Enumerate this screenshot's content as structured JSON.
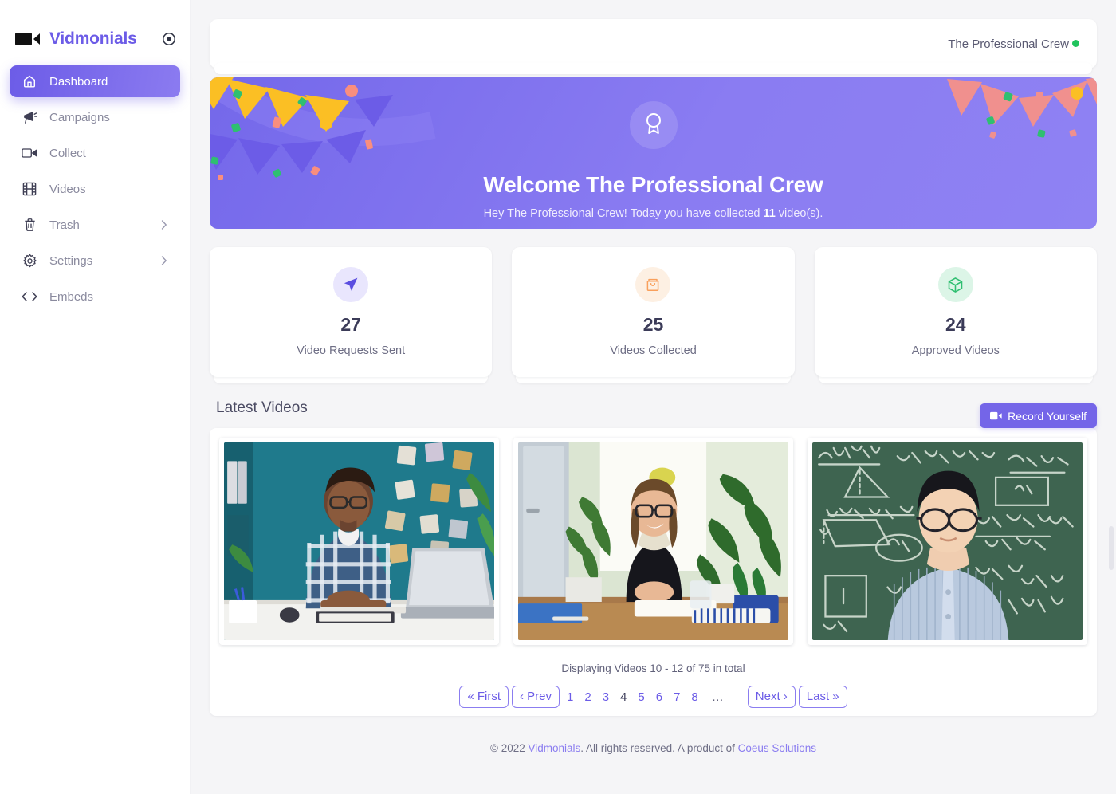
{
  "brand": {
    "name": "Vidmonials",
    "logo_icon": "video-camera-icon",
    "toggle_icon": "circle-target-icon",
    "accent_color": "#6C5CE7"
  },
  "sidebar": {
    "items": [
      {
        "label": "Dashboard",
        "icon": "home-icon",
        "active": true,
        "has_chevron": false
      },
      {
        "label": "Campaigns",
        "icon": "megaphone-icon",
        "active": false,
        "has_chevron": false
      },
      {
        "label": "Collect",
        "icon": "video-icon",
        "active": false,
        "has_chevron": false
      },
      {
        "label": "Videos",
        "icon": "film-icon",
        "active": false,
        "has_chevron": false
      },
      {
        "label": "Trash",
        "icon": "trash-icon",
        "active": false,
        "has_chevron": true
      },
      {
        "label": "Settings",
        "icon": "gear-icon",
        "active": false,
        "has_chevron": true
      },
      {
        "label": "Embeds",
        "icon": "code-icon",
        "active": false,
        "has_chevron": false
      }
    ]
  },
  "topbar": {
    "user_name": "The Professional Crew",
    "status_color": "#21c45d"
  },
  "welcome": {
    "badge_icon": "award-icon",
    "title": "Welcome The Professional Crew",
    "subtitle_prefix": "Hey The Professional Crew! Today you have collected ",
    "subtitle_count": "11",
    "subtitle_suffix": " video(s).",
    "background_color": "#8a7cf2"
  },
  "stats": [
    {
      "value": "27",
      "label": "Video Requests Sent",
      "icon": "paper-plane-icon",
      "icon_color": "#5b4ee0",
      "icon_bg": "#e9e6fd"
    },
    {
      "value": "25",
      "label": "Videos Collected",
      "icon": "shopping-bag-icon",
      "icon_color": "#f9a05c",
      "icon_bg": "#fdf0e3"
    },
    {
      "value": "24",
      "label": "Approved Videos",
      "icon": "package-icon",
      "icon_color": "#2fbf71",
      "icon_bg": "#dcf5e7"
    }
  ],
  "videos": {
    "section_title": "Latest Videos",
    "record_button_label": "Record Yourself",
    "record_button_icon": "video-camera-icon",
    "items": [
      {
        "alt": "Man in plaid shirt at desk with laptop in teal office"
      },
      {
        "alt": "Person with glasses smiling at desk in bright plant-filled room"
      },
      {
        "alt": "Man in striped shirt in front of a chalkboard with geometry formulas"
      }
    ],
    "pagination_info": "Displaying Videos 10 - 12 of 75 in total",
    "pagination": {
      "first_label": "« First",
      "prev_label": "‹ Prev",
      "pages": [
        "1",
        "2",
        "3",
        "4",
        "5",
        "6",
        "7",
        "8"
      ],
      "current_page": "4",
      "ellipsis": "…",
      "next_label": "Next ›",
      "last_label": "Last »"
    }
  },
  "footer": {
    "copyright": "© 2022 ",
    "brand_link": "Vidmonials",
    "middle": ". All rights reserved. A product of ",
    "company_link": "Coeus Solutions"
  }
}
